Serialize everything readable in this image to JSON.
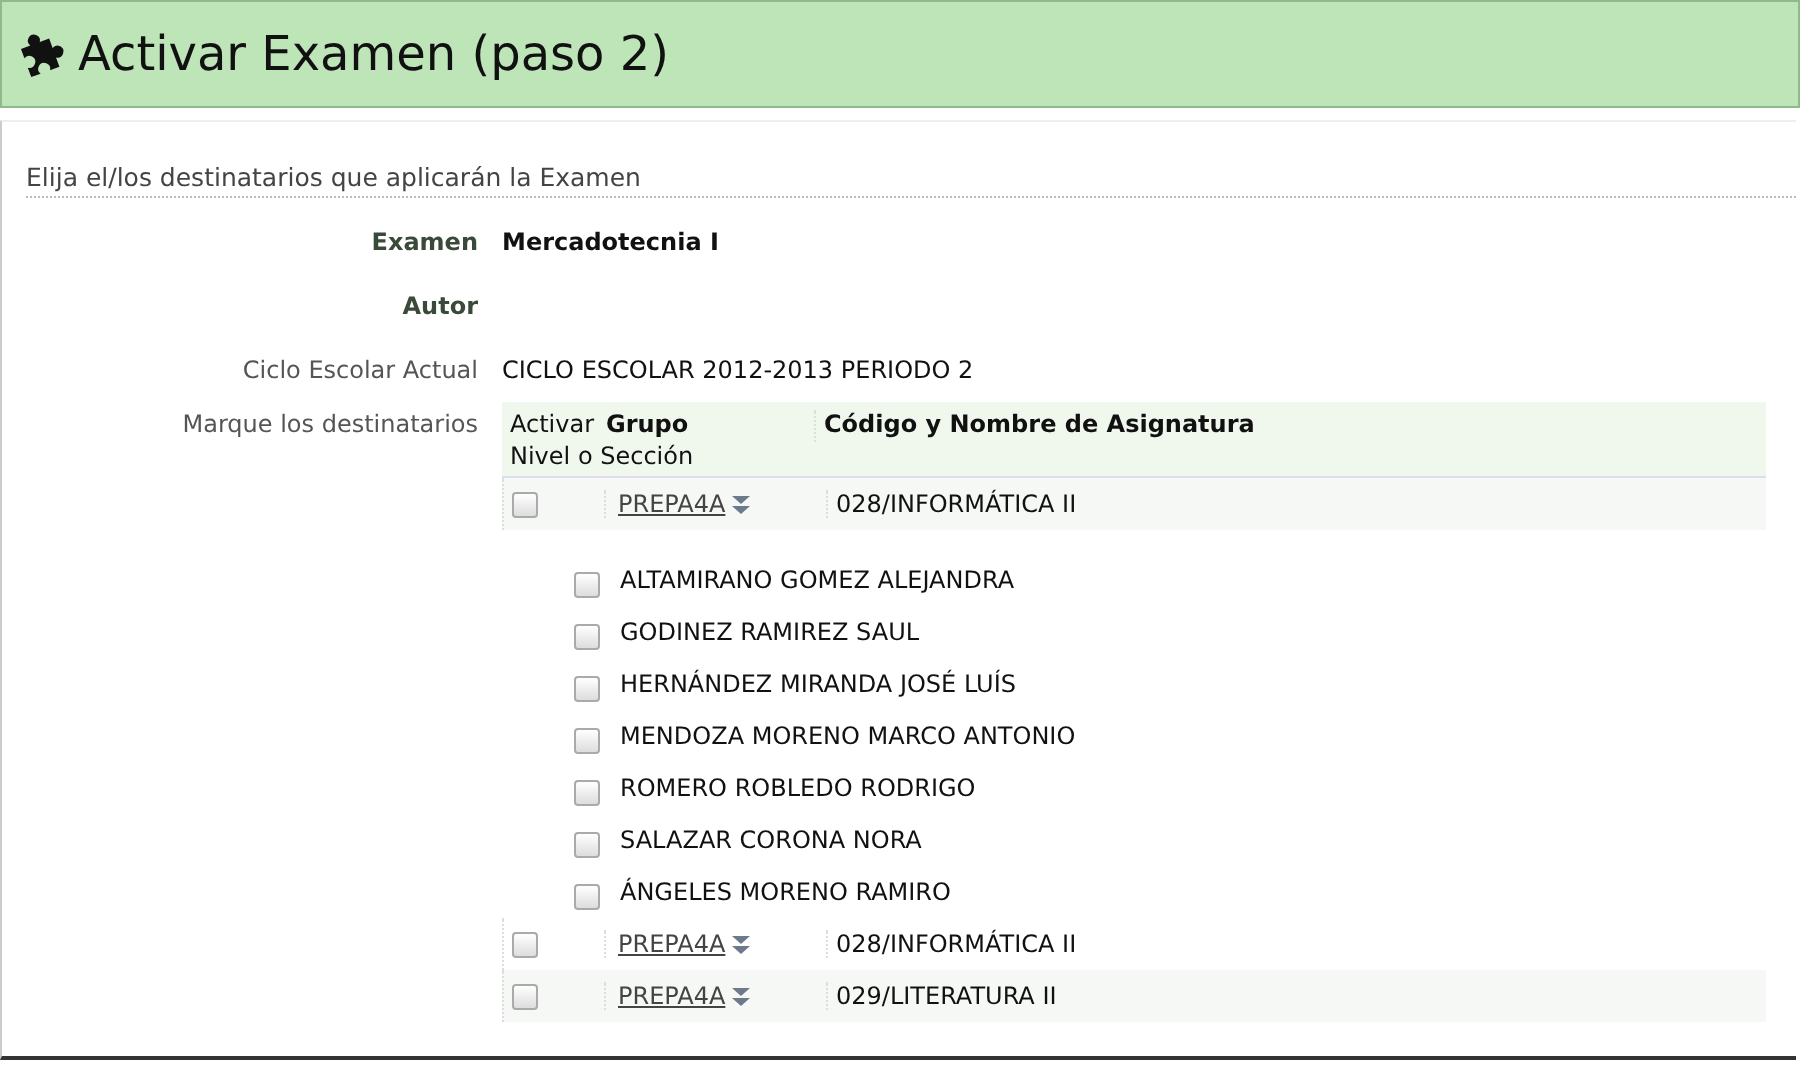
{
  "header": {
    "title": "Activar Examen (paso 2)"
  },
  "instructions": "Elija el/los destinatarios que aplicarán la Examen",
  "fields": [
    {
      "label": "Examen",
      "value": "Mercadotecnia I",
      "bold": true
    },
    {
      "label": "Autor",
      "bold": true
    },
    {
      "label": "Ciclo Escolar Actual",
      "value": "CICLO ESCOLAR 2012-2013 PERIODO 2",
      "bold": false
    }
  ],
  "recipients": {
    "label": "Marque los destinatarios",
    "columns": [
      {
        "lines": [
          "Activar",
          "Nivel o Sección"
        ]
      },
      {
        "lines": [
          "Grupo"
        ]
      },
      {
        "lines": [
          "Código y Nombre de Asignatura"
        ]
      }
    ],
    "groups": [
      {
        "group": "PREPA4A",
        "subject": "028/INFORMÁTICA II",
        "checked": false,
        "children": [
          {
            "name": "ALTAMIRANO GOMEZ ALEJANDRA",
            "checked": false
          },
          {
            "name": "GODINEZ RAMIREZ SAUL",
            "checked": false
          },
          {
            "name": "HERNÁNDEZ MIRANDA JOSÉ LUÍS",
            "checked": false
          },
          {
            "name": "MENDOZA MORENO MARCO ANTONIO",
            "checked": false
          },
          {
            "name": "ROMERO ROBLEDO RODRIGO",
            "checked": false
          },
          {
            "name": "SALAZAR CORONA NORA",
            "checked": false
          },
          {
            "name": "ÁNGELES MORENO RAMIRO",
            "checked": false
          }
        ]
      },
      {
        "group": "PREPA4A",
        "subject": "028/INFORMÁTICA II",
        "checked": false
      },
      {
        "group": "PREPA4A",
        "subject": "029/LITERATURA II",
        "checked": false
      }
    ]
  }
}
